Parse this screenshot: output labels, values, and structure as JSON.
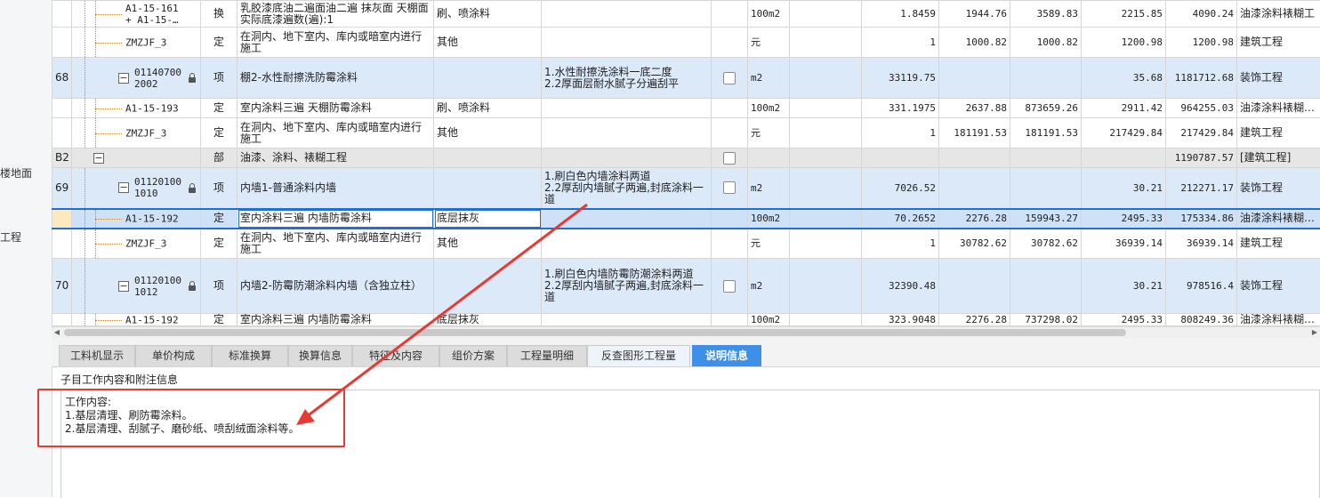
{
  "sidebar": {
    "stubs": [
      "楼地面",
      "工程"
    ]
  },
  "colors": {
    "item_row": "#dce9f8",
    "section_row": "#e6e6e6",
    "active_tab": "#3d8fe8",
    "annotation_red": "#e83a32"
  },
  "rows": [
    {
      "type": "sub",
      "level": 2,
      "code": "A1-15-161\n+ A1-15-…",
      "cat": "换",
      "name": "乳胶漆底油二遍面油二遍 抹灰面 天棚面 实际底漆遍数(遍):1",
      "spec": "刷、喷涂料",
      "feature": "",
      "unit": "100m2",
      "qty": "1.8459",
      "price": "1944.76",
      "total": "3589.83",
      "rate": "2215.85",
      "amount": "4090.24",
      "major": "油漆涂料裱糊工"
    },
    {
      "type": "sub",
      "level": 2,
      "code": "ZMZJF_3",
      "cat": "定",
      "name": "在洞内、地下室内、库内或暗室内进行施工",
      "spec": "其他",
      "feature": "",
      "unit": "元",
      "qty": "1",
      "price": "1000.82",
      "total": "1000.82",
      "rate": "1200.98",
      "amount": "1200.98",
      "major": "建筑工程"
    },
    {
      "type": "item",
      "level": 1,
      "seq": "68",
      "code": "01140700\n2002",
      "locked": true,
      "cat": "项",
      "name": "棚2-水性耐擦洗防霉涂料",
      "spec": "",
      "feature": "1.水性耐擦洗涂料一底二度\n2.2厚面层耐水腻子分遍刮平",
      "check": true,
      "unit": "m2",
      "qty": "33119.75",
      "price": "",
      "total": "",
      "rate": "35.68",
      "amount": "1181712.68",
      "major": "装饰工程"
    },
    {
      "type": "sub",
      "level": 2,
      "code": "A1-15-193",
      "cat": "定",
      "name": "室内涂料三遍 天棚防霉涂料",
      "spec": "刷、喷涂料",
      "feature": "",
      "unit": "100m2",
      "qty": "331.1975",
      "price": "2637.88",
      "total": "873659.26",
      "rate": "2911.42",
      "amount": "964255.03",
      "major": "油漆涂料裱糊…"
    },
    {
      "type": "sub",
      "level": 2,
      "code": "ZMZJF_3",
      "cat": "定",
      "name": "在洞内、地下室内、库内或暗室内进行施工",
      "spec": "其他",
      "feature": "",
      "unit": "元",
      "qty": "1",
      "price": "181191.53",
      "total": "181191.53",
      "rate": "217429.84",
      "amount": "217429.84",
      "major": "建筑工程"
    },
    {
      "type": "section",
      "level": 0,
      "seq": "B2",
      "cat": "部",
      "name": "油漆、涂料、裱糊工程",
      "spec": "",
      "feature": "",
      "check": true,
      "unit": "",
      "qty": "",
      "price": "",
      "total": "",
      "rate": "",
      "amount": "1190787.57",
      "major": "[建筑工程]"
    },
    {
      "type": "item",
      "level": 1,
      "seq": "69",
      "code": "01120100\n1010",
      "locked": true,
      "cat": "项",
      "name": "内墙1-普通涂料内墙",
      "spec": "",
      "feature": "1.刷白色内墙涂料两道\n2.2厚刮内墙腻子两遍,封底涂料一道",
      "check": true,
      "unit": "m2",
      "qty": "7026.52",
      "price": "",
      "total": "",
      "rate": "30.21",
      "amount": "212271.17",
      "major": "装饰工程"
    },
    {
      "type": "selected",
      "level": 2,
      "code": "A1-15-192",
      "cat": "定",
      "name": "室内涂料三遍 内墙防霉涂料",
      "spec": "底层抹灰",
      "feature": "",
      "unit": "100m2",
      "qty": "70.2652",
      "price": "2276.28",
      "total": "159943.27",
      "rate": "2495.33",
      "amount": "175334.86",
      "major": "油漆涂料裱糊…"
    },
    {
      "type": "sub",
      "level": 2,
      "code": "ZMZJF_3",
      "cat": "定",
      "name": "在洞内、地下室内、库内或暗室内进行施工",
      "spec": "其他",
      "feature": "",
      "unit": "元",
      "qty": "1",
      "price": "30782.62",
      "total": "30782.62",
      "rate": "36939.14",
      "amount": "36939.14",
      "major": "建筑工程"
    },
    {
      "type": "item",
      "level": 1,
      "seq": "70",
      "code": "01120100\n1012",
      "locked": true,
      "cat": "项",
      "name": "内墙2-防霉防潮涂料内墙（含独立柱）",
      "spec": "",
      "feature": "1.刷白色内墙防霉防潮涂料两道\n2.2厚刮内墙腻子两遍,封底涂料一道",
      "check": true,
      "unit": "m2",
      "qty": "32390.48",
      "price": "",
      "total": "",
      "rate": "30.21",
      "amount": "978516.4",
      "major": "装饰工程"
    },
    {
      "type": "sub",
      "level": 2,
      "code": "A1-15-192",
      "cat": "定",
      "name": "室内涂料三遍 内墙防霉涂料",
      "spec": "底层抹灰",
      "feature": "",
      "unit": "100m2",
      "qty": "323.9048",
      "price": "2276.28",
      "total": "737298.02",
      "rate": "2495.33",
      "amount": "808249.36",
      "major": "油漆涂料裱糊…"
    }
  ],
  "tabs": [
    "工料机显示",
    "单价构成",
    "标准换算",
    "换算信息",
    "特征及内容",
    "组价方案",
    "工程量明细",
    "反查图形工程量",
    "说明信息"
  ],
  "active_tab": "说明信息",
  "panel": {
    "title": "子目工作内容和附注信息",
    "heading": "工作内容:",
    "lines": [
      "1.基层清理、刷防霉涂料。",
      "2.基层清理、刮腻子、磨砂纸、喷刮绒面涂料等。"
    ]
  }
}
